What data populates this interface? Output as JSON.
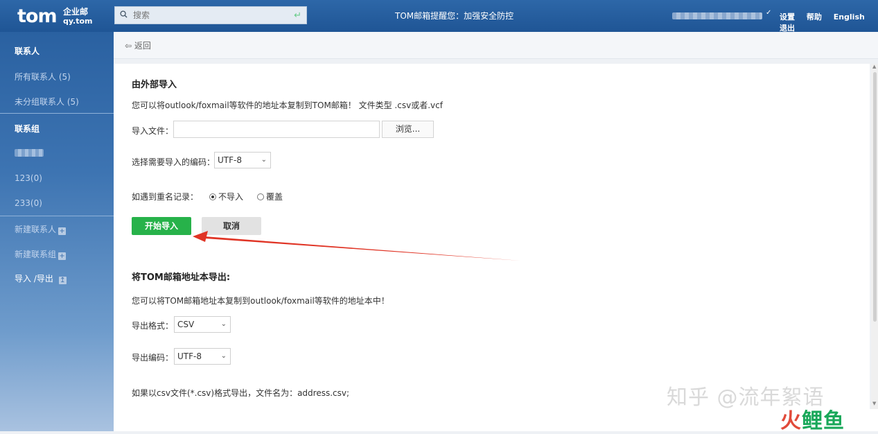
{
  "header": {
    "logo_main": "tom",
    "logo_sub1": "企业邮",
    "logo_sub2": "qy.tom",
    "search_placeholder": "搜索",
    "notice": "TOM邮箱提醒您：加强安全防控",
    "links": [
      "设置",
      "帮助",
      "English",
      "退出"
    ]
  },
  "sidebar": {
    "contacts_header": "联系人",
    "all_contacts": "所有联系人 (5)",
    "ungrouped": "未分组联系人 (5)",
    "groups_header": "联系组",
    "groups": [
      "123(0)",
      "233(0)"
    ],
    "new_contact": "新建联系人",
    "new_group": "新建联系组",
    "import_export": "导入 /导出"
  },
  "back_label": "返回",
  "import": {
    "title": "由外部导入",
    "desc": "您可以将outlook/foxmail等软件的地址本复制到TOM邮箱！  文件类型 .csv或者.vcf",
    "file_label": "导入文件：",
    "browse_label": "浏览...",
    "encoding_label": "选择需要导入的编码：",
    "encoding_value": "UTF-8",
    "duplicate_label": "如遇到重名记录：",
    "option_skip": "不导入",
    "option_overwrite": "覆盖",
    "start_button": "开始导入",
    "cancel_button": "取消"
  },
  "export": {
    "title": "将TOM邮箱地址本导出:",
    "desc": "您可以将TOM邮箱地址本复制到outlook/foxmail等软件的地址本中！",
    "format_label": "导出格式：",
    "format_value": "CSV",
    "encoding_label": "导出编码：",
    "encoding_value": "UTF-8",
    "csv_note": "如果以csv文件(*.csv)格式导出，文件名为：address.csv;"
  },
  "watermark": {
    "text": "知乎 @流年絮语",
    "logo_a": "火",
    "logo_b": "鲤鱼"
  }
}
